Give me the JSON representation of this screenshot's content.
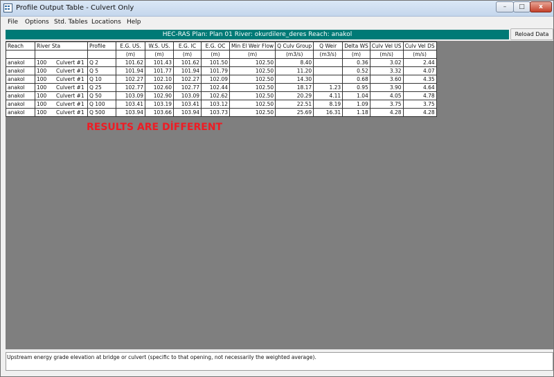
{
  "window": {
    "title": "Profile Output Table - Culvert Only",
    "minimize_glyph": "–",
    "maximize_glyph": "□",
    "close_glyph": "x"
  },
  "menu": [
    "File",
    "Options",
    "Std. Tables",
    "Locations",
    "Help"
  ],
  "header": {
    "info": "HEC-RAS  Plan: Plan 01   River: okurdilere_deres   Reach: anakol",
    "reload_label": "Reload Data"
  },
  "table": {
    "columns": [
      "Reach",
      "River Sta",
      "Profile",
      "E.G. US.",
      "W.S. US.",
      "E.G. IC",
      "E.G. OC",
      "Min El Weir Flow",
      "Q Culv Group",
      "Q Weir",
      "Delta WS",
      "Culv Vel US",
      "Culv Vel DS"
    ],
    "units": [
      "",
      "",
      "",
      "(m)",
      "(m)",
      "(m)",
      "(m)",
      "(m)",
      "(m3/s)",
      "(m3/s)",
      "(m)",
      "(m/s)",
      "(m/s)"
    ],
    "rows": [
      [
        "anakol",
        "100",
        "Culvert #1",
        "Q 2",
        "101.62",
        "101.43",
        "101.62",
        "101.50",
        "102.50",
        "8.40",
        "",
        "0.36",
        "3.02",
        "2.44"
      ],
      [
        "anakol",
        "100",
        "Culvert #1",
        "Q 5",
        "101.94",
        "101.77",
        "101.94",
        "101.79",
        "102.50",
        "11.20",
        "",
        "0.52",
        "3.32",
        "4.07"
      ],
      [
        "anakol",
        "100",
        "Culvert #1",
        "Q 10",
        "102.27",
        "102.10",
        "102.27",
        "102.09",
        "102.50",
        "14.30",
        "",
        "0.68",
        "3.60",
        "4.35"
      ],
      [
        "anakol",
        "100",
        "Culvert #1",
        "Q 25",
        "102.77",
        "102.60",
        "102.77",
        "102.44",
        "102.50",
        "18.17",
        "1.23",
        "0.95",
        "3.90",
        "4.64"
      ],
      [
        "anakol",
        "100",
        "Culvert #1",
        "Q 50",
        "103.09",
        "102.90",
        "103.09",
        "102.62",
        "102.50",
        "20.29",
        "4.11",
        "1.04",
        "4.05",
        "4.78"
      ],
      [
        "anakol",
        "100",
        "Culvert #1",
        "Q 100",
        "103.41",
        "103.19",
        "103.41",
        "103.12",
        "102.50",
        "22.51",
        "8.19",
        "1.09",
        "3.75",
        "3.75"
      ],
      [
        "anakol",
        "100",
        "Culvert #1",
        "Q 500",
        "103.94",
        "103.66",
        "103.94",
        "103.73",
        "102.50",
        "25.69",
        "16.31",
        "1.18",
        "4.28",
        "4.28"
      ]
    ]
  },
  "annotation": "RESULTS ARE DİFFERENT",
  "status_text": "Upstream energy grade elevation at bridge or culvert (specific to that opening, not necessarily the weighted average).",
  "colors": {
    "band": "#007a76",
    "area": "#7f7f7f",
    "annotation": "#ee1c24"
  }
}
